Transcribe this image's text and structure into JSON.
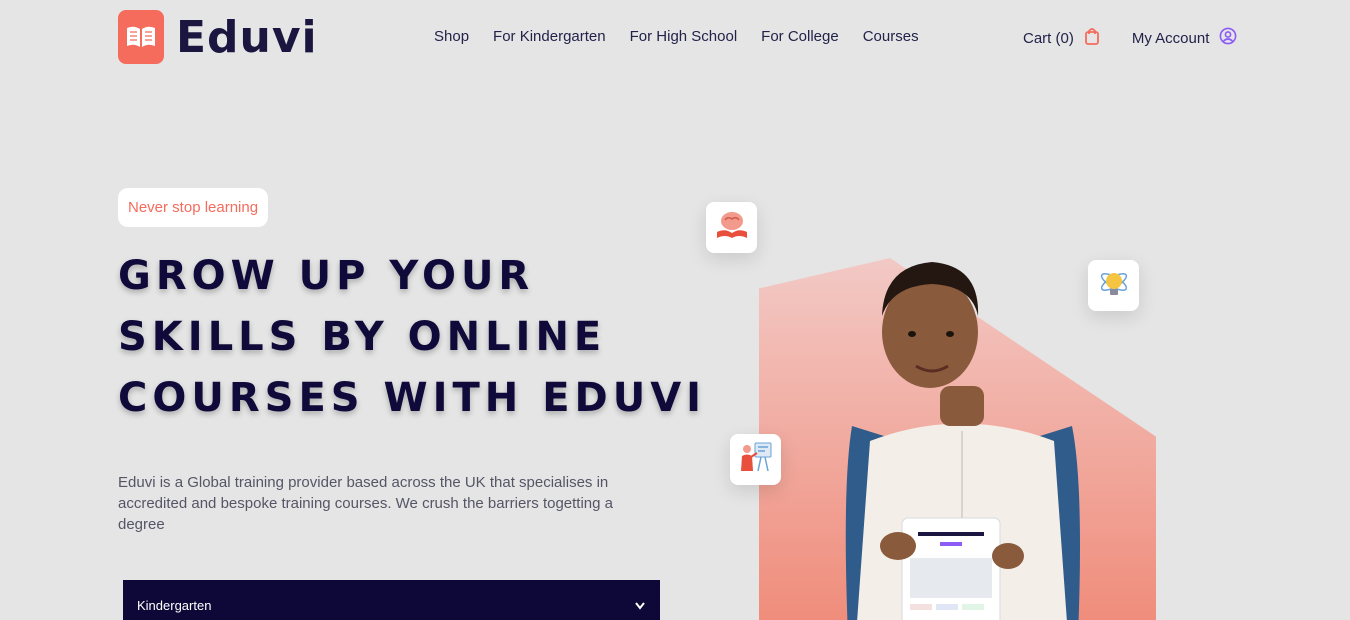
{
  "brand": {
    "name": "Eduvi",
    "accent": "#f56b5c",
    "dark": "#0e0838"
  },
  "nav": {
    "links": [
      "Shop",
      "For Kindergarten",
      "For High School",
      "For College",
      "Courses"
    ],
    "cart_label": "Cart (0)",
    "account_label": "My Account"
  },
  "hero": {
    "tagline": "Never stop learning",
    "headline": [
      "GROW UP YOUR",
      "SKILLS BY ONLINE",
      "COURSES WITH EDUVI"
    ],
    "description": "Eduvi is a Global training provider based across the UK that specialises in accredited and bespoke training courses. We crush the barriers togetting a degree",
    "select": {
      "value": "Kindergarten"
    }
  },
  "icons": [
    "brain-book-icon",
    "atom-bulb-icon",
    "teacher-board-icon",
    "shopping-bag-icon",
    "user-circle-icon",
    "chevron-down-icon"
  ]
}
